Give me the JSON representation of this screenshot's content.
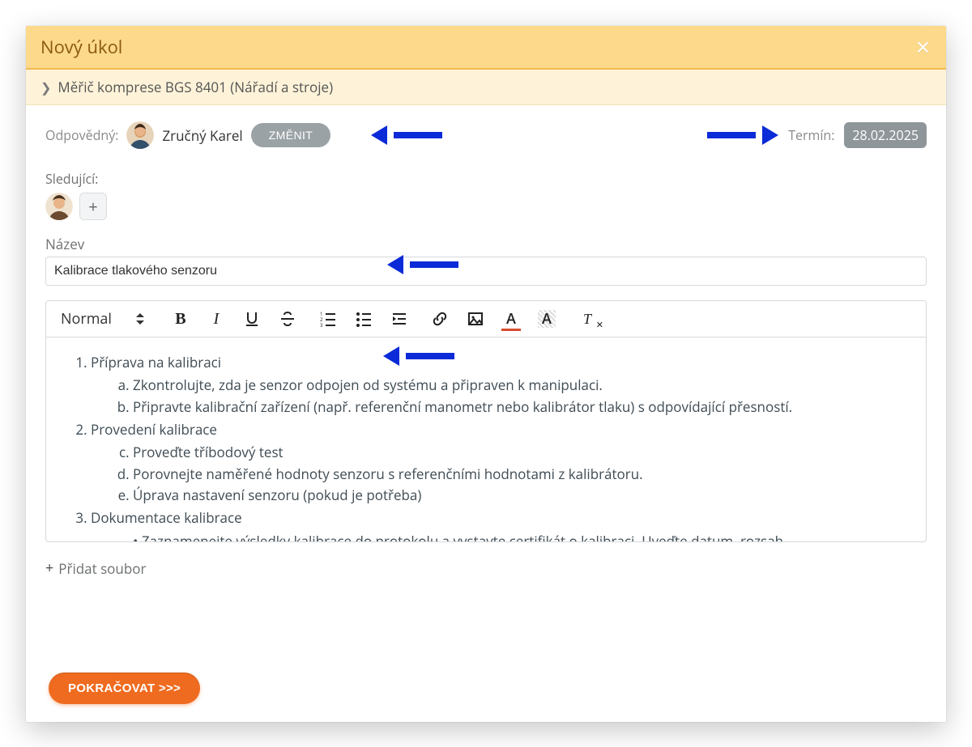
{
  "modal": {
    "title": "Nový úkol",
    "close_icon": "×"
  },
  "breadcrumb": {
    "chevron": "❯",
    "text": "Měřič komprese BGS 8401 (Nářadí a stroje)"
  },
  "responsible": {
    "label": "Odpovědný:",
    "user_name": "Zručný Karel",
    "change_btn": "ZMĚNIT"
  },
  "deadline": {
    "label": "Termín:",
    "value": "28.02.2025"
  },
  "followers": {
    "label": "Sledující:",
    "add_icon": "+"
  },
  "name_field": {
    "label": "Název",
    "value": "Kalibrace tlakového senzoru"
  },
  "toolbar": {
    "format_select": "Normal"
  },
  "editor_content": {
    "items": [
      {
        "title": "Příprava na kalibraci",
        "subs": [
          "Zkontrolujte, zda je senzor odpojen od systému a připraven k manipulaci.",
          "Připravte kalibrační zařízení (např. referenční manometr nebo kalibrátor tlaku) s odpovídající přesností."
        ],
        "start": 1
      },
      {
        "title": "Provedení kalibrace",
        "subs": [
          "Proveďte tříbodový test",
          "Porovnejte naměřené hodnoty senzoru s referenčními hodnotami z kalibrátoru.",
          "Úprava nastavení senzoru (pokud je potřeba)"
        ],
        "start": 3
      },
      {
        "title": "Dokumentace kalibrace",
        "bullets": [
          "Zaznamenejte výsledky kalibrace do protokolu a vystavte certifikát o kalibraci. Uveďte datum, rozsah"
        ]
      }
    ]
  },
  "add_file": {
    "icon": "+",
    "label": "Přidat soubor"
  },
  "footer": {
    "continue_btn": "POKRAČOVAT >>>"
  }
}
